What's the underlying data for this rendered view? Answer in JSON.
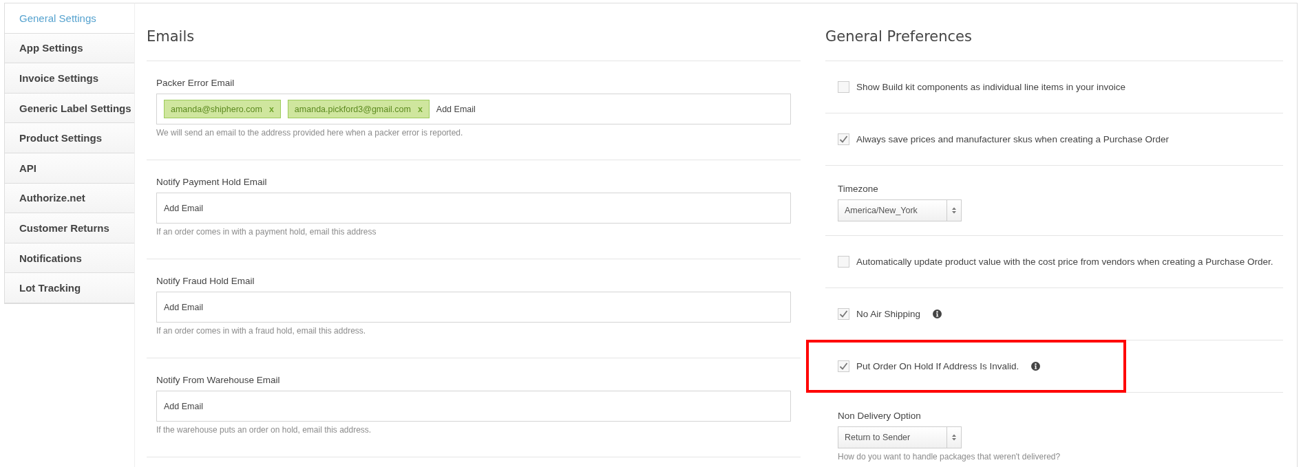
{
  "sidebar": {
    "items": [
      {
        "label": "General Settings",
        "selected": true
      },
      {
        "label": "App Settings",
        "selected": false
      },
      {
        "label": "Invoice Settings",
        "selected": false
      },
      {
        "label": "Generic Label Settings",
        "selected": false
      },
      {
        "label": "Product Settings",
        "selected": false
      },
      {
        "label": "API",
        "selected": false
      },
      {
        "label": "Authorize.net",
        "selected": false
      },
      {
        "label": "Customer Returns",
        "selected": false
      },
      {
        "label": "Notifications",
        "selected": false
      },
      {
        "label": "Lot Tracking",
        "selected": false
      }
    ]
  },
  "emails": {
    "title": "Emails",
    "fields": [
      {
        "label": "Packer Error Email",
        "tags": [
          {
            "text": "amanda@shiphero.com",
            "remove": "x"
          },
          {
            "text": "amanda.pickford3@gmail.com",
            "remove": "x"
          }
        ],
        "placeholder": "Add Email",
        "help": "We will send an email to the address provided here when a packer error is reported."
      },
      {
        "label": "Notify Payment Hold Email",
        "placeholder": "Add Email",
        "help": "If an order comes in with a payment hold, email this address"
      },
      {
        "label": "Notify Fraud Hold Email",
        "placeholder": "Add Email",
        "help": "If an order comes in with a fraud hold, email this address."
      },
      {
        "label": "Notify From Warehouse Email",
        "placeholder": "Add Email",
        "help": "If the warehouse puts an order on hold, email this address."
      }
    ]
  },
  "preferences": {
    "title": "General Preferences",
    "items": [
      {
        "kind": "checkbox",
        "label": "Show Build kit components as individual line items in your invoice",
        "checked": false,
        "info": false,
        "highlighted": false
      },
      {
        "kind": "checkbox",
        "label": "Always save prices and manufacturer skus when creating a Purchase Order",
        "checked": true,
        "info": false,
        "highlighted": false
      },
      {
        "kind": "select",
        "label": "Timezone",
        "value": "America/New_York"
      },
      {
        "kind": "checkbox",
        "label": "Automatically update product value with the cost price from vendors when creating a Purchase Order.",
        "checked": false,
        "info": false,
        "highlighted": false
      },
      {
        "kind": "checkbox",
        "label": "No Air Shipping",
        "checked": true,
        "info": true,
        "highlighted": false
      },
      {
        "kind": "checkbox",
        "label": "Put Order On Hold If Address Is Invalid.",
        "checked": true,
        "info": true,
        "highlighted": true
      },
      {
        "kind": "select",
        "label": "Non Delivery Option",
        "value": "Return to Sender",
        "help": "How do you want to handle packages that weren't delivered?"
      }
    ]
  }
}
